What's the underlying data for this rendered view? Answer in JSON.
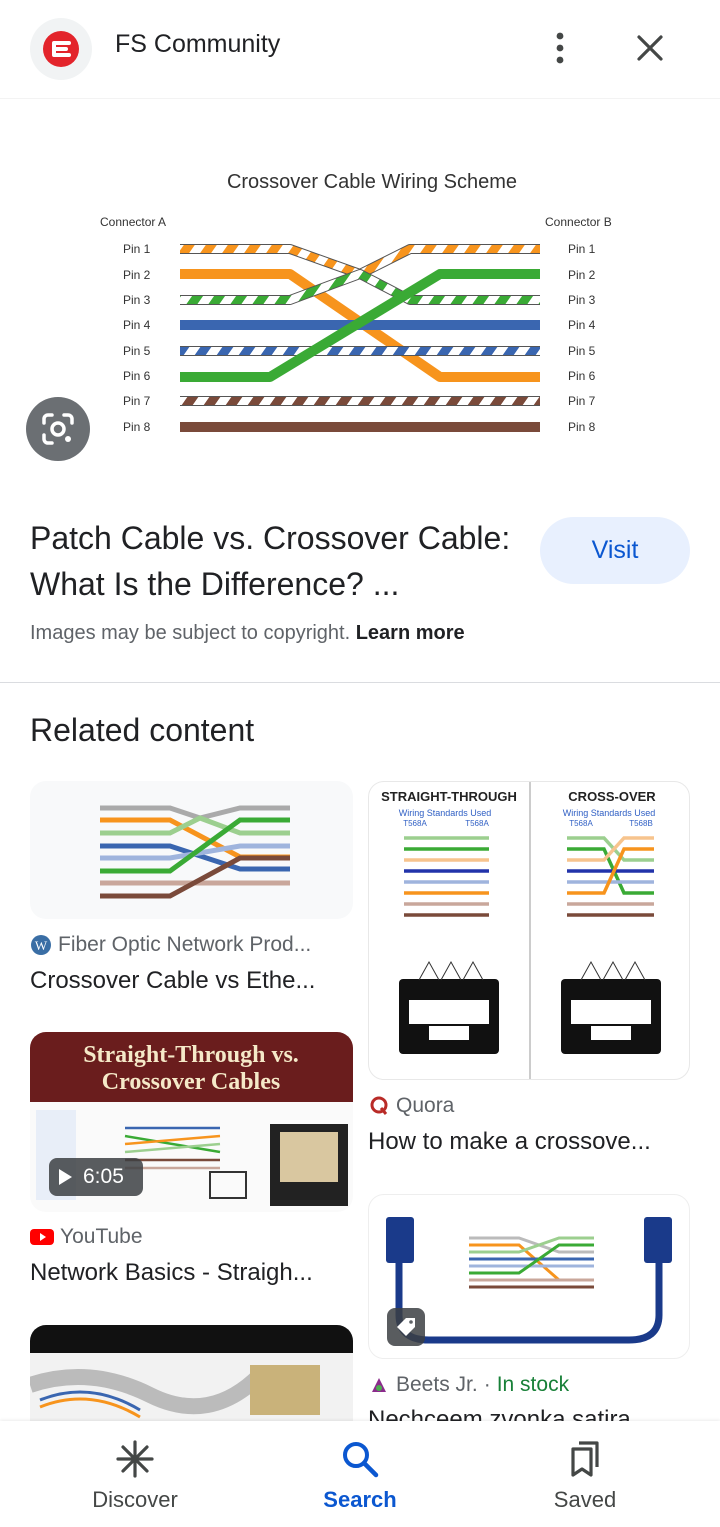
{
  "header": {
    "site_name": "FS Community",
    "brand_color": "#e3242b"
  },
  "hero": {
    "diagram_title": "Crossover Cable Wiring Scheme",
    "connector_a": "Connector A",
    "connector_b": "Connector B",
    "pins_left": [
      "Pin 1",
      "Pin 2",
      "Pin 3",
      "Pin 4",
      "Pin 5",
      "Pin 6",
      "Pin 7",
      "Pin 8"
    ],
    "pins_right": [
      "Pin 1",
      "Pin 2",
      "Pin 3",
      "Pin 4",
      "Pin 5",
      "Pin 6",
      "Pin 7",
      "Pin 8"
    ]
  },
  "result": {
    "title": "Patch Cable vs. Crossover Cable: What Is the Difference? ...",
    "visit_label": "Visit",
    "copyright_text": "Images may be subject to copyright.",
    "learn_more": "Learn more"
  },
  "related": {
    "heading": "Related content",
    "cards": [
      {
        "source": "Fiber Optic Network Prod...",
        "title": "Crossover Cable vs Ethe...",
        "icon": "wordpress-icon"
      },
      {
        "source": "Quora",
        "title": "How to make a crossove...",
        "icon": "quora-icon",
        "image_text": {
          "left_head": "STRAIGHT-THROUGH",
          "right_head": "CROSS-OVER",
          "sub": "Wiring Standards Used",
          "a": "T568A",
          "b": "T568B"
        }
      },
      {
        "source": "YouTube",
        "title": "Network Basics - Straigh...",
        "icon": "youtube-icon",
        "duration": "6:05",
        "image_text": {
          "line1": "Straight-Through vs.",
          "line2": "Crossover Cables"
        }
      },
      {
        "source": "Beets Jr.",
        "stock": "In stock",
        "title": "Nechceem zvonka satira",
        "icon": "store-icon"
      }
    ]
  },
  "bottom_nav": {
    "items": [
      {
        "label": "Discover"
      },
      {
        "label": "Search"
      },
      {
        "label": "Saved"
      }
    ]
  },
  "colors": {
    "accent": "#0b57d0",
    "stock_green": "#188038"
  }
}
